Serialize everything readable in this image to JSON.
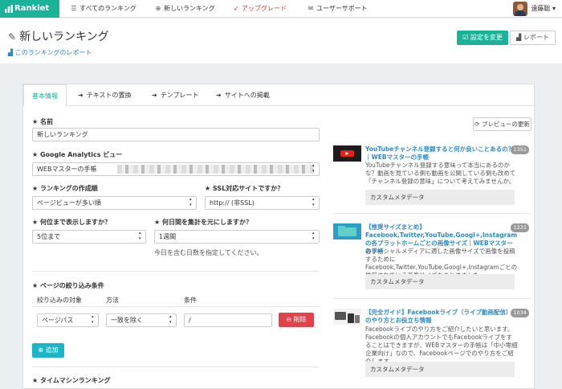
{
  "nav": {
    "brand": "Ranklet",
    "items": [
      {
        "label": "すべてのランキング",
        "icon": "list-icon"
      },
      {
        "label": "新しいランキング",
        "icon": "plus-circle-icon"
      },
      {
        "label": "アップグレード",
        "icon": "rocket-icon"
      },
      {
        "label": "ユーザーサポート",
        "icon": "mail-icon"
      }
    ],
    "user": "遠藤聡"
  },
  "header": {
    "title": "新しいランキング",
    "report_link": "このランキングのレポート",
    "save_button": "設定を変更",
    "report_button": "レポート"
  },
  "tabs": [
    {
      "label": "基本情報"
    },
    {
      "label": "テキストの置換"
    },
    {
      "label": "テンプレート"
    },
    {
      "label": "サイトへの掲載"
    }
  ],
  "form": {
    "name_label": "★ 名前",
    "name_value": "新しいランキング",
    "ga_label": "★ Google Analytics ビュー",
    "ga_value": "WEBマスターの手帳",
    "ranking_label": "★ ランキングの作成順",
    "ranking_value": "ページビューが多い順",
    "ssl_label": "★ SSL対応サイトですか？",
    "ssl_value": "http:// (非SSL)",
    "rank_count_label": "★ 何位まで表示しますか？",
    "rank_count_value": "5位まで",
    "days_label": "★ 何日間を集計を元にしますか？",
    "days_value": "1週間",
    "days_hint": "今日を含む日数を指定してください。",
    "filter_label": "★ ページの絞り込み条件",
    "filter_headers": [
      "絞り込みの対象",
      "方法",
      "条件"
    ],
    "filter_target": "ページパス",
    "filter_method": "一致を除く",
    "filter_condition": "/",
    "delete_button": "削除",
    "add_button": "追加",
    "timemachine_label": "★ タイムマシンランキング"
  },
  "preview": {
    "refresh_button": "プレビューの更新",
    "items": [
      {
        "title": "YouTubeチャンネル登録すると何か良いことあるの？｜WEBマスターの手帳",
        "count": "1351",
        "desc": "YouTubeチャンネル登録する意味って本当にあるのかな？動画を見ている側も動画を公開している側も改めて「チャンネル登録の意味」について考えてみませんか。",
        "meta": "カスタムメタデータ"
      },
      {
        "title": "【推奨サイズまとめ】Facebook,Twitter,YouTube,Googl+,Instagramの各プラットホームごとの画像サイズ｜WEBマスターの手帳",
        "count": "1231",
        "desc": "各ソーシャルメディアに適した画像サイズで画像を投稿するためにFacebook,Twitter,YouTube,Googl+,Instagramごとの推奨されている画像サイズをまとめました。",
        "meta": "カスタムメタデータ"
      },
      {
        "title": "【完全ガイド】Facebookライブ（ライブ動画配信）のやり方とお役立ち情報",
        "count": "1034",
        "desc": "Facebookライブのやり方をご紹介したいと思います。Facebookの個人アカウントでもFacebookライブをすることはできますが、WEBマスターの手帳は「中小零細企業向け」なので、Facebookページでのやり方をご紹介します。",
        "meta": "カスタムメタデータ"
      }
    ]
  },
  "colors": {
    "brand": "#19b39a",
    "danger": "#e0434b",
    "info": "#19b6c8",
    "link": "#2a8bc7",
    "upgrade": "#e8343a"
  }
}
